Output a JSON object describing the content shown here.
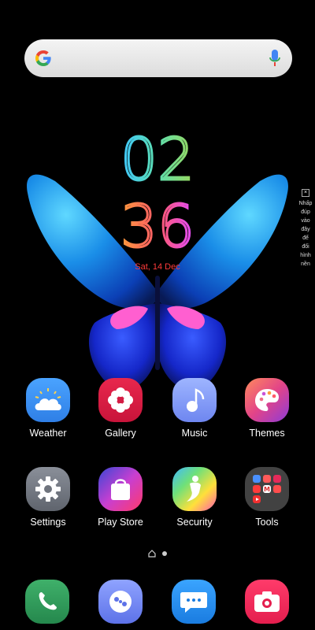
{
  "search": {
    "placeholder": ""
  },
  "clock": {
    "hours": "02",
    "minutes": "36",
    "date": "Sat, 14 Dec"
  },
  "side_hint": {
    "close": "×",
    "text": [
      "Nhấp",
      "đúp",
      "vào",
      "đây",
      "để",
      "đổi",
      "hình",
      "nền"
    ]
  },
  "apps": [
    {
      "label": "Weather",
      "icon": "weather-icon"
    },
    {
      "label": "Gallery",
      "icon": "gallery-icon"
    },
    {
      "label": "Music",
      "icon": "music-icon"
    },
    {
      "label": "Themes",
      "icon": "themes-icon"
    },
    {
      "label": "Settings",
      "icon": "settings-icon"
    },
    {
      "label": "Play Store",
      "icon": "play-store-icon"
    },
    {
      "label": "Security",
      "icon": "security-icon"
    },
    {
      "label": "Tools",
      "icon": "tools-folder-icon"
    }
  ],
  "dock": [
    {
      "icon": "phone-icon"
    },
    {
      "icon": "contacts-icon"
    },
    {
      "icon": "messages-icon"
    },
    {
      "icon": "camera-icon"
    }
  ],
  "page_indicator": {
    "pages": 2,
    "current": 2
  },
  "colors": {
    "accent_red": "#ff3b3b",
    "wallpaper_bg": "#000000"
  }
}
